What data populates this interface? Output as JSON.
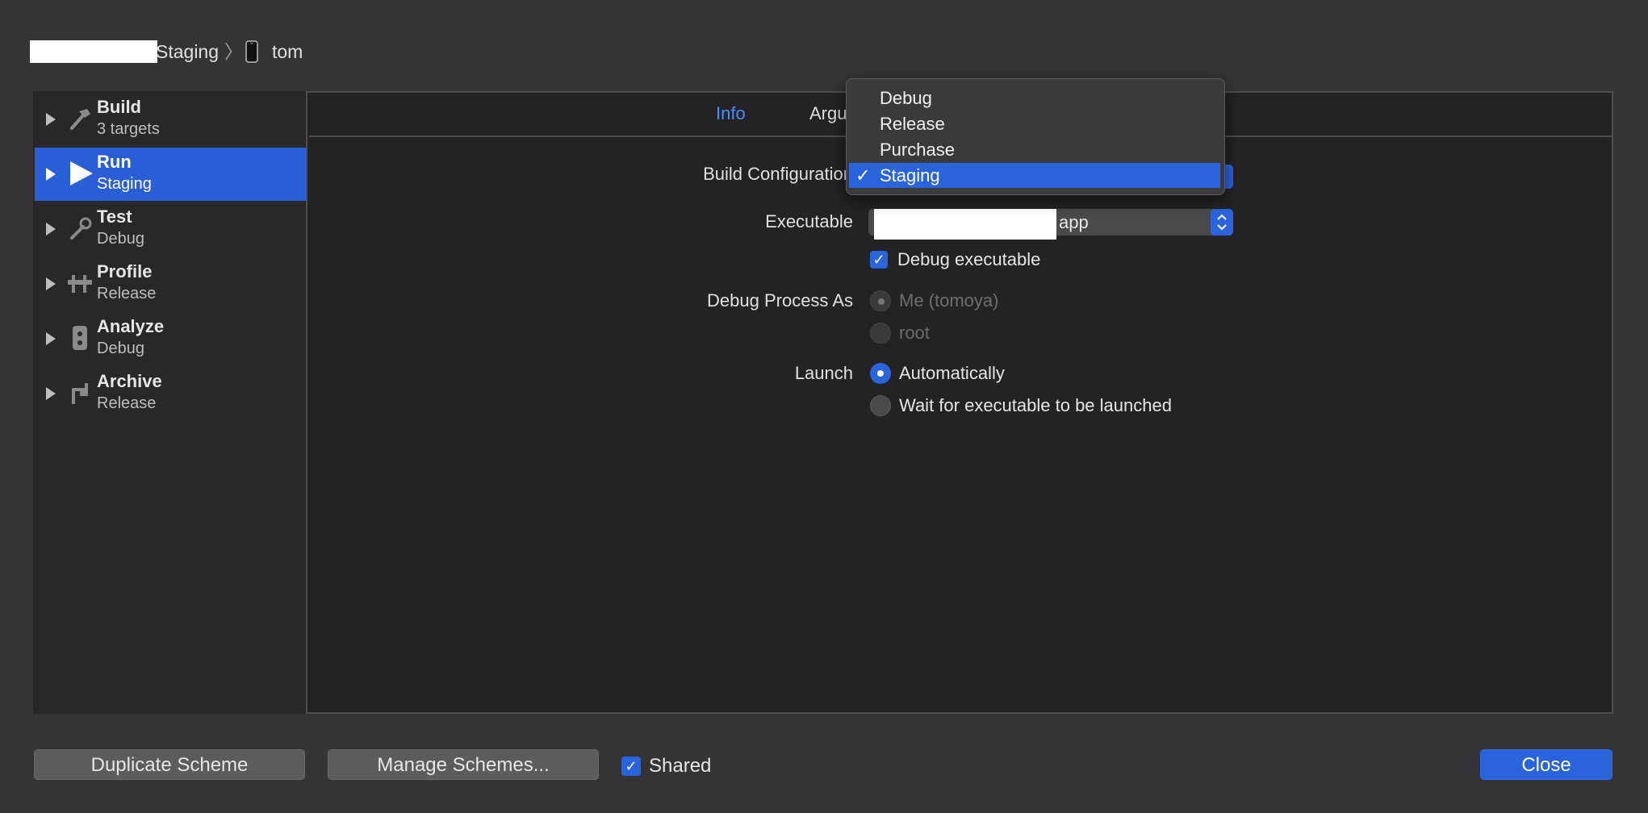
{
  "breadcrumb": {
    "scheme_suffix": "Staging",
    "separator": "〉",
    "device_icon": "iphone-icon",
    "device": "tom"
  },
  "sidebar": {
    "items": [
      {
        "title": "Build",
        "subtitle": "3 targets",
        "icon": "hammer-icon",
        "selected": false
      },
      {
        "title": "Run",
        "subtitle": "Staging",
        "icon": "play-icon",
        "selected": true
      },
      {
        "title": "Test",
        "subtitle": "Debug",
        "icon": "wrench-icon",
        "selected": false
      },
      {
        "title": "Profile",
        "subtitle": "Release",
        "icon": "instruments-icon",
        "selected": false
      },
      {
        "title": "Analyze",
        "subtitle": "Debug",
        "icon": "analyze-icon",
        "selected": false
      },
      {
        "title": "Archive",
        "subtitle": "Release",
        "icon": "archive-icon",
        "selected": false
      }
    ]
  },
  "tabs": {
    "info": "Info",
    "arguments": "Argu"
  },
  "form": {
    "build_configuration_label": "Build Configuration",
    "executable_label": "Executable",
    "executable_value_suffix": "app",
    "debug_executable_label": "Debug executable",
    "debug_executable_checked": true,
    "debug_process_as_label": "Debug Process As",
    "debug_process_options": [
      "Me (tomoya)",
      "root"
    ],
    "launch_label": "Launch",
    "launch_options": [
      "Automatically",
      "Wait for executable to be launched"
    ],
    "launch_selected": "Automatically"
  },
  "config_menu": {
    "items": [
      "Debug",
      "Release",
      "Purchase",
      "Staging"
    ],
    "selected": "Staging",
    "check": "✓"
  },
  "footer": {
    "duplicate_scheme": "Duplicate Scheme",
    "manage_schemes": "Manage Schemes...",
    "shared_label": "Shared",
    "shared_checked": true,
    "close": "Close"
  },
  "colors": {
    "accent": "#2a64dc",
    "active_tab": "#4b8df8"
  }
}
